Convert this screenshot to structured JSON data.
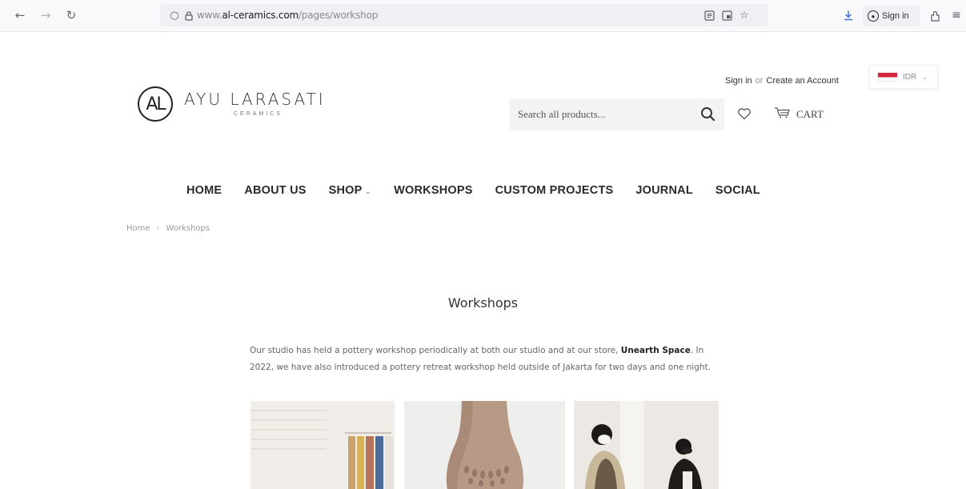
{
  "browser": {
    "url_prefix": "www.",
    "url_domain": "al-ceramics.com",
    "url_path": "/pages/workshop",
    "signin_label": "Sign in"
  },
  "header": {
    "logo_mark": "AL",
    "brand_name": "AYU LARASATI",
    "brand_sub": "CERAMICS",
    "sign_in": "Sign in",
    "or": "or",
    "create_account": "Create an Account",
    "currency": "IDR",
    "search_placeholder": "Search all products...",
    "cart_label": "CART"
  },
  "nav": {
    "items": [
      "HOME",
      "ABOUT US",
      "SHOP",
      "WORKSHOPS",
      "CUSTOM PROJECTS",
      "JOURNAL",
      "SOCIAL"
    ]
  },
  "breadcrumb": {
    "home": "Home",
    "separator": "›",
    "current": "Workshops"
  },
  "main": {
    "title": "Workshops",
    "intro_before": "Our studio has held a pottery workshop periodically at both our studio and at our store, ",
    "intro_link": "Unearth Space",
    "intro_after": ". In 2022, we have also introduced a pottery retreat workshop held outside of Jakarta for two days and one night."
  },
  "colors": {
    "flag_red": "#d0253a",
    "text_dark": "#2a2a2a",
    "search_bg": "#f3f3f3"
  }
}
